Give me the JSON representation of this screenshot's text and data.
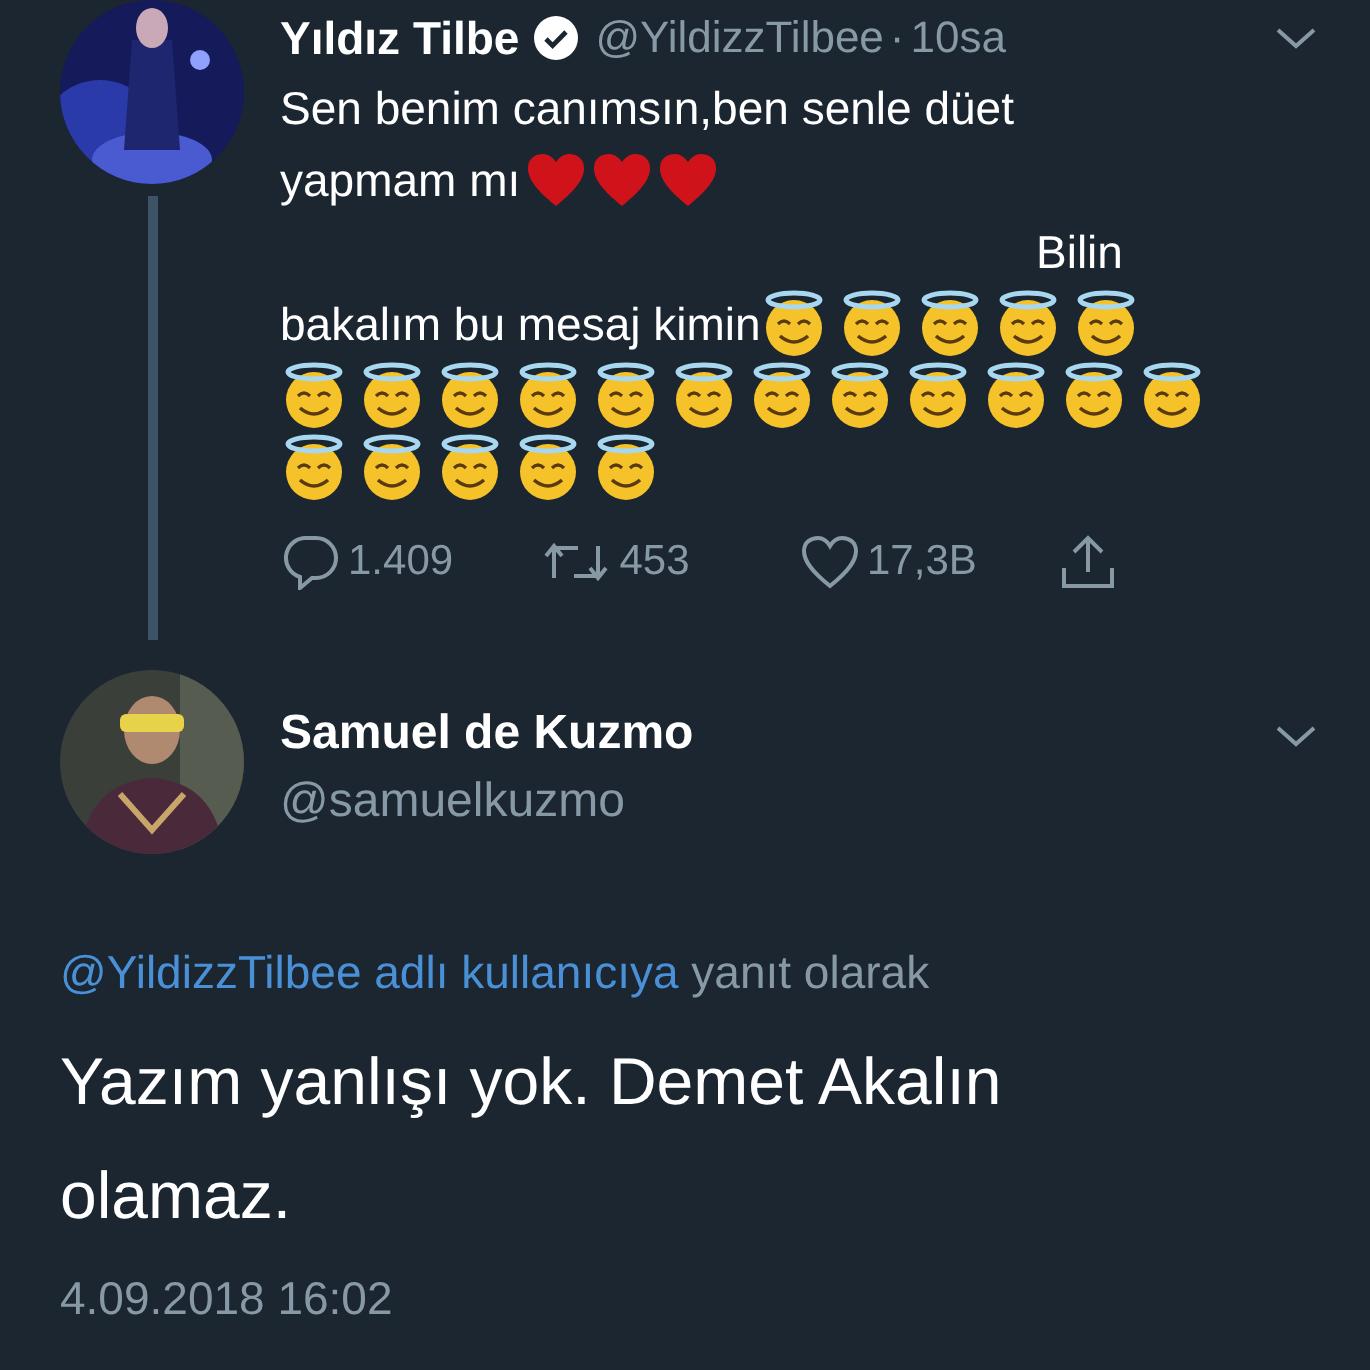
{
  "tweet": {
    "name": "Yıldız Tilbe",
    "verified": true,
    "handle": "@YildizzTilbee",
    "separator": "·",
    "time": "10sa",
    "lines": [
      {
        "kind": "plain",
        "parts": [
          {
            "kind": "text",
            "text": "Sen benim canımsın,ben senle düet"
          }
        ]
      },
      {
        "kind": "plain",
        "parts": [
          {
            "kind": "text",
            "text": "yapmam mı"
          },
          {
            "kind": "heart"
          },
          {
            "kind": "heart"
          },
          {
            "kind": "heart"
          }
        ]
      },
      {
        "kind": "indented",
        "parts": [
          {
            "kind": "text",
            "text": "Bilin"
          }
        ]
      },
      {
        "kind": "plain",
        "parts": [
          {
            "kind": "text",
            "text": "bakalım bu mesaj kimin"
          },
          {
            "kind": "halo"
          },
          {
            "kind": "halo"
          },
          {
            "kind": "halo"
          },
          {
            "kind": "halo"
          },
          {
            "kind": "halo"
          }
        ]
      },
      {
        "kind": "plain",
        "parts": [
          {
            "kind": "halo"
          },
          {
            "kind": "halo"
          },
          {
            "kind": "halo"
          },
          {
            "kind": "halo"
          },
          {
            "kind": "halo"
          },
          {
            "kind": "halo"
          },
          {
            "kind": "halo"
          },
          {
            "kind": "halo"
          },
          {
            "kind": "halo"
          },
          {
            "kind": "halo"
          },
          {
            "kind": "halo"
          },
          {
            "kind": "halo"
          }
        ]
      },
      {
        "kind": "plain",
        "parts": [
          {
            "kind": "halo"
          },
          {
            "kind": "halo"
          },
          {
            "kind": "halo"
          },
          {
            "kind": "halo"
          },
          {
            "kind": "halo"
          }
        ]
      }
    ],
    "actions": [
      {
        "kind": "reply",
        "count": "1.409"
      },
      {
        "kind": "retweet",
        "count": "453"
      },
      {
        "kind": "like",
        "count": "17,3B"
      },
      {
        "kind": "share"
      }
    ]
  },
  "reply": {
    "name": "Samuel de Kuzmo",
    "handle": "@samuelkuzmo",
    "reply_to": {
      "mention": "@YildizzTilbee adlı kullanıcıya",
      "suffix": "yanıt olarak"
    },
    "lines": [
      "Yazım yanlışı yok. Demet Akalın",
      "olamaz."
    ],
    "timestamp": "4.09.2018 16:02"
  }
}
